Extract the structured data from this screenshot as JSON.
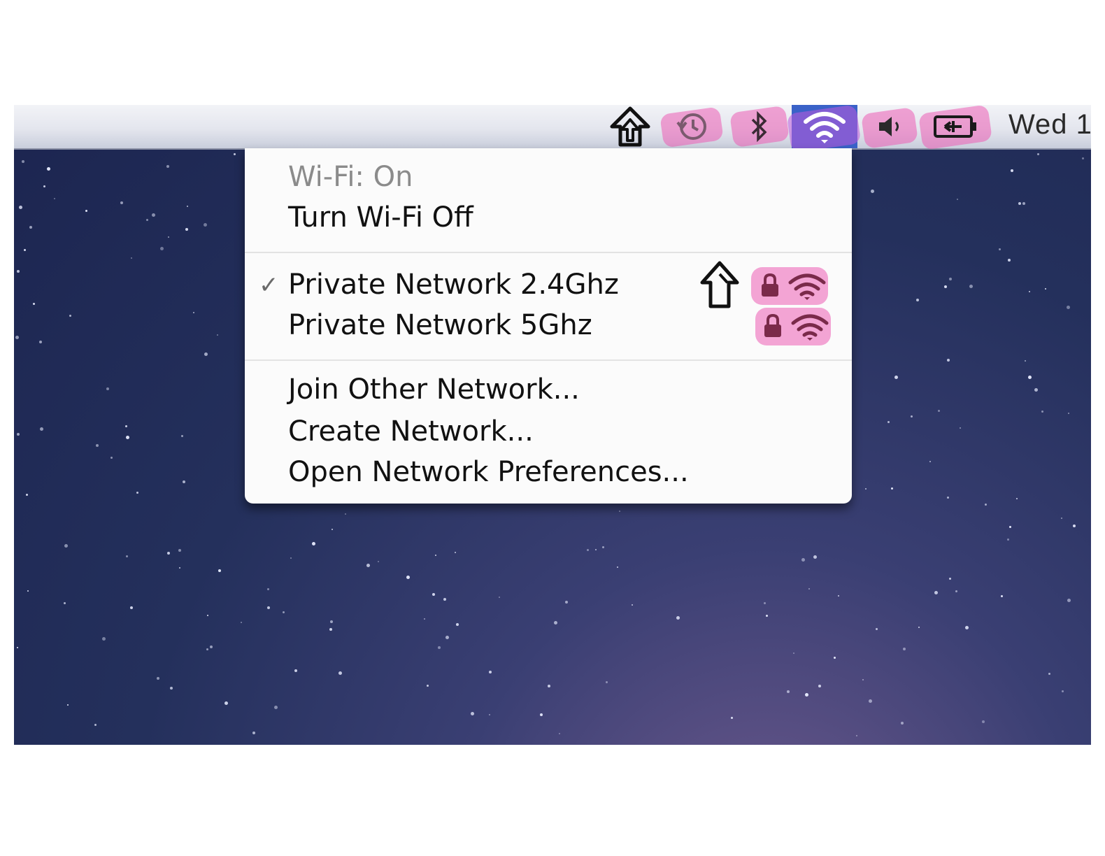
{
  "menubar": {
    "icons": [
      "home-arrow-icon",
      "time-machine-icon",
      "bluetooth-icon",
      "wifi-icon",
      "volume-icon",
      "battery-icon"
    ],
    "clock_text": "Wed 1",
    "highlight_color": "#3a62c8",
    "annotation_color": "#ec5cb4"
  },
  "menu": {
    "status": "Wi-Fi: On",
    "toggle": "Turn Wi-Fi Off",
    "networks": [
      {
        "name": "Private Network 2.4Ghz",
        "checked": true,
        "secured": true
      },
      {
        "name": "Private Network 5Ghz",
        "checked": false,
        "secured": true
      }
    ],
    "check_mark": "✓",
    "actions": {
      "join": "Join Other Network...",
      "create": "Create Network...",
      "prefs": "Open Network Preferences..."
    }
  }
}
